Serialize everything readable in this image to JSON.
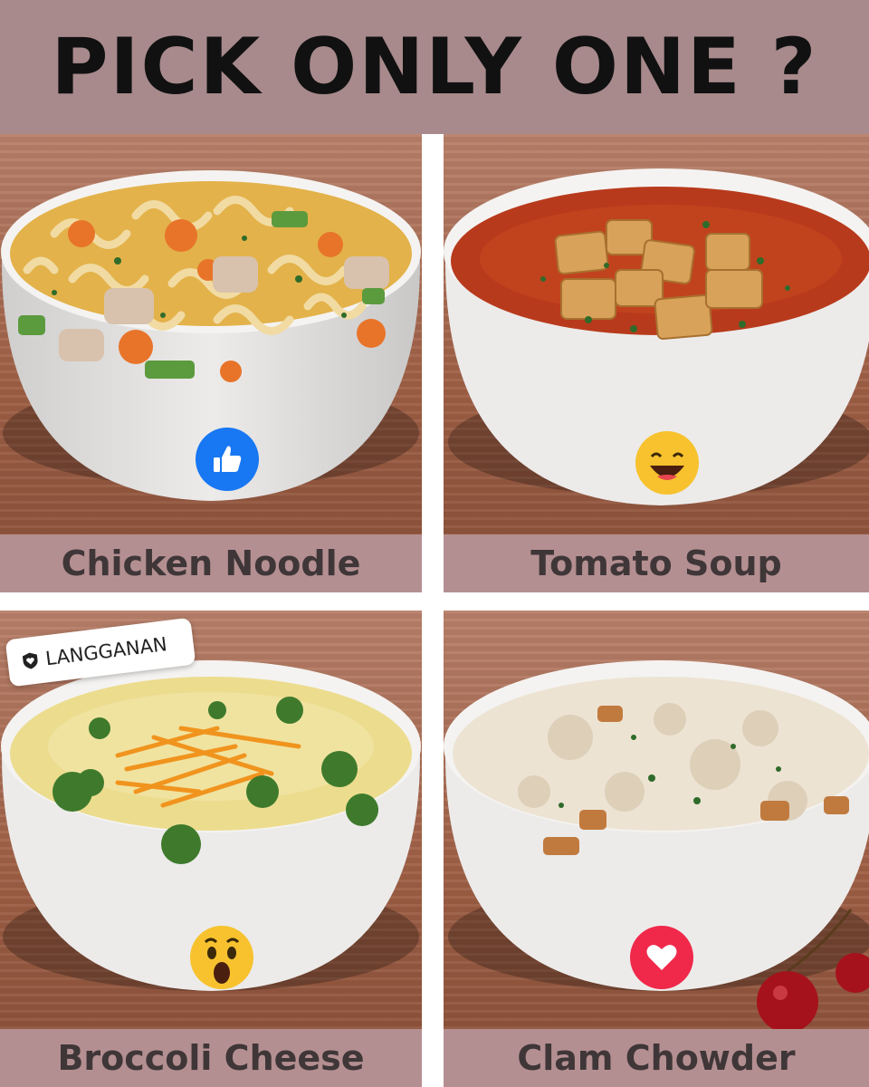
{
  "header": {
    "title": "PICK ONLY ONE ?"
  },
  "options": [
    {
      "label": "Chicken Noodle",
      "reaction_icon": "like-icon",
      "reaction_color": "#1877f2"
    },
    {
      "label": "Tomato Soup",
      "reaction_icon": "haha-emoji-icon",
      "reaction_color": "#f7c22e"
    },
    {
      "label": "Broccoli Cheese",
      "reaction_icon": "wow-emoji-icon",
      "reaction_color": "#f7c22e"
    },
    {
      "label": "Clam Chowder",
      "reaction_icon": "love-heart-icon",
      "reaction_color": "#f0284a"
    }
  ],
  "badge": {
    "label": "LANGGANAN"
  }
}
